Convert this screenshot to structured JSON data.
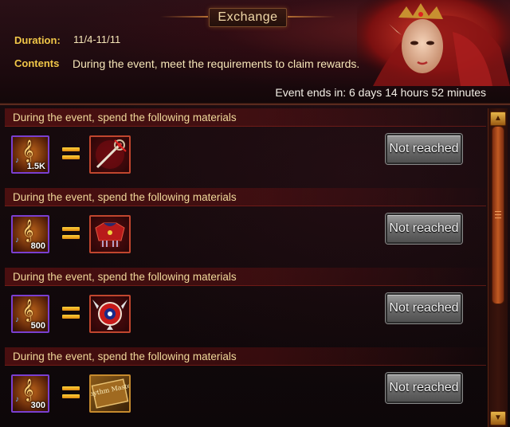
{
  "header": {
    "title": "Exchange",
    "duration_label": "Duration:",
    "duration_value": "11/4-11/11",
    "contents_label": "Contents",
    "contents_value": "During the event, meet the requirements to claim rewards.",
    "countdown": "Event ends in: 6 days 14 hours 52 minutes"
  },
  "rows": [
    {
      "title": "During the event, spend the following materials",
      "material_qty": "1.5K",
      "reward_icon": "staff-weapon-icon",
      "button_label": "Not reached"
    },
    {
      "title": "During the event, spend the following materials",
      "material_qty": "800",
      "reward_icon": "winged-armor-icon",
      "button_label": "Not reached"
    },
    {
      "title": "During the event, spend the following materials",
      "material_qty": "500",
      "reward_icon": "winged-emblem-icon",
      "button_label": "Not reached"
    },
    {
      "title": "During the event, spend the following materials",
      "material_qty": "300",
      "reward_icon": "rhythm-master-title-icon",
      "button_label": "Not reached",
      "reward_text": "Rhythm Master"
    }
  ],
  "colors": {
    "accent_gold": "#f0c648",
    "button_gray": "#6c6c6c",
    "material_border": "#7a3fd0",
    "reward_border": "#c0462e"
  }
}
